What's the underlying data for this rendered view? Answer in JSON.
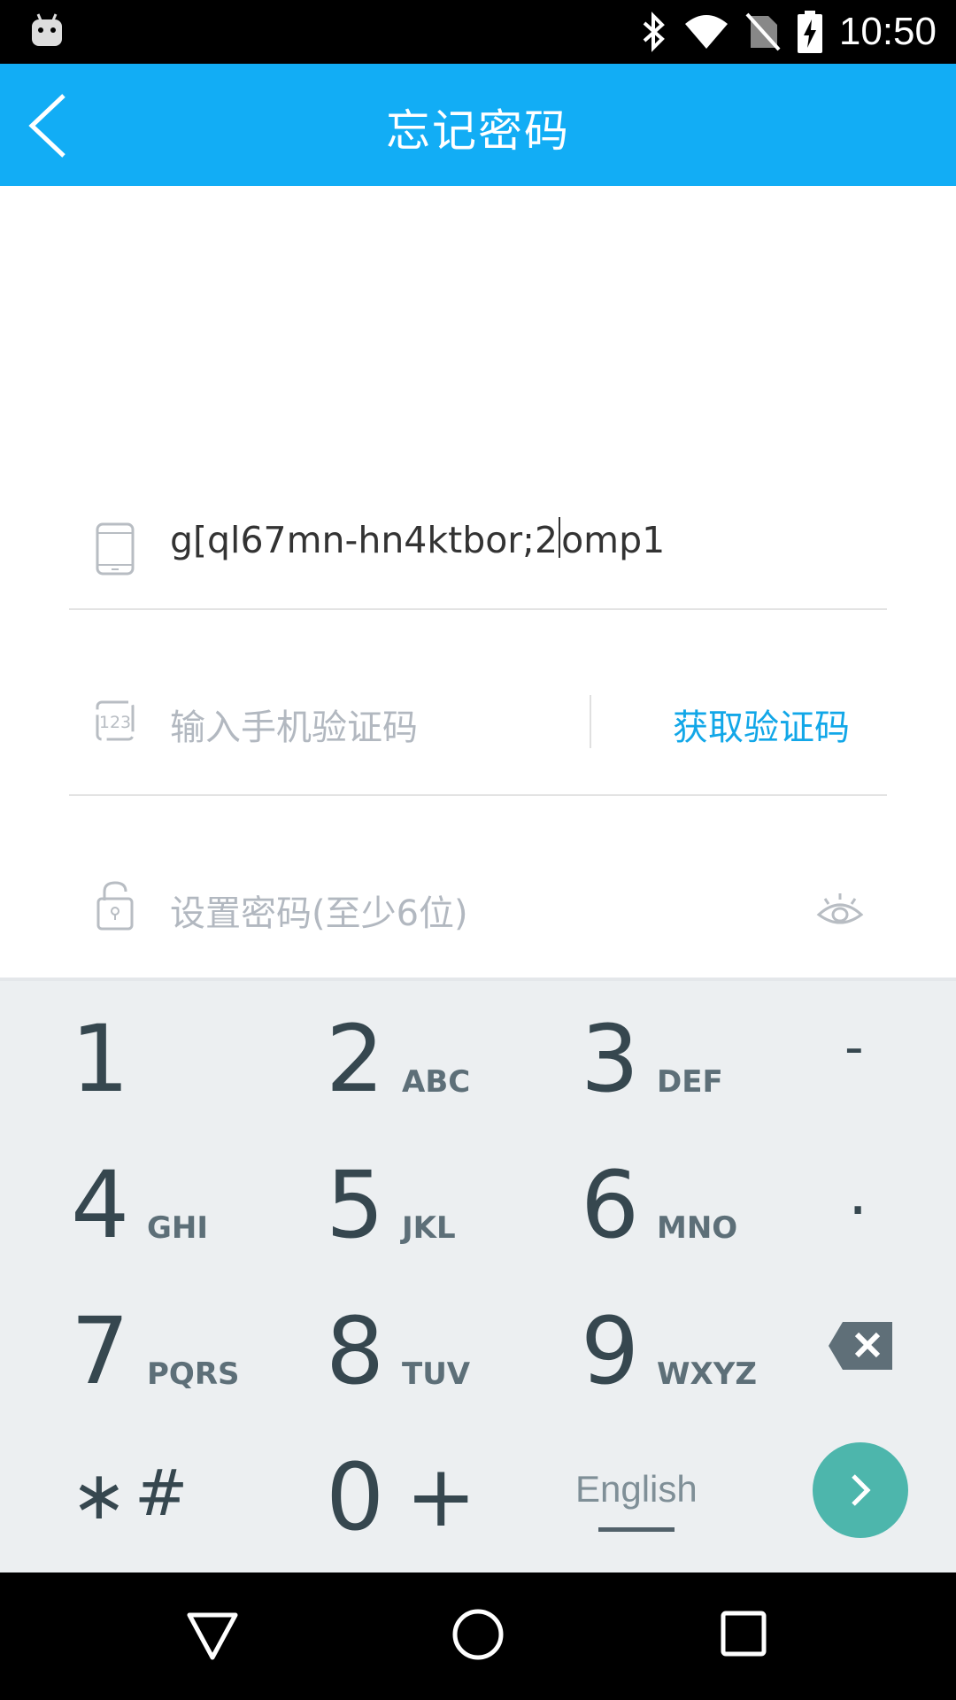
{
  "status_bar": {
    "time": "10:50"
  },
  "header": {
    "title": "忘记密码"
  },
  "form": {
    "phone_value_before_cursor": "g[ql67mn-hn4ktbor;2",
    "phone_value_after_cursor": "omp1",
    "code_placeholder": "输入手机验证码",
    "get_code_label": "获取验证码",
    "code_icon_text": "123",
    "password_placeholder": "设置密码(至少6位)"
  },
  "keyboard": {
    "keys": [
      {
        "num": "1",
        "letters": ""
      },
      {
        "num": "2",
        "letters": "ABC"
      },
      {
        "num": "3",
        "letters": "DEF"
      },
      {
        "num": "4",
        "letters": "GHI"
      },
      {
        "num": "5",
        "letters": "JKL"
      },
      {
        "num": "6",
        "letters": "MNO"
      },
      {
        "num": "7",
        "letters": "PQRS"
      },
      {
        "num": "8",
        "letters": "TUV"
      },
      {
        "num": "9",
        "letters": "WXYZ"
      }
    ],
    "dash": "-",
    "dot": ".",
    "star": "∗",
    "hash": "#",
    "zero": "0",
    "plus": "+",
    "language": "English",
    "backspace_icon": "backspace-icon",
    "go_icon": "chevron-right-icon",
    "go_color": "#4db6ac"
  },
  "colors": {
    "accent": "#12adf5",
    "link": "#12a7e8"
  }
}
